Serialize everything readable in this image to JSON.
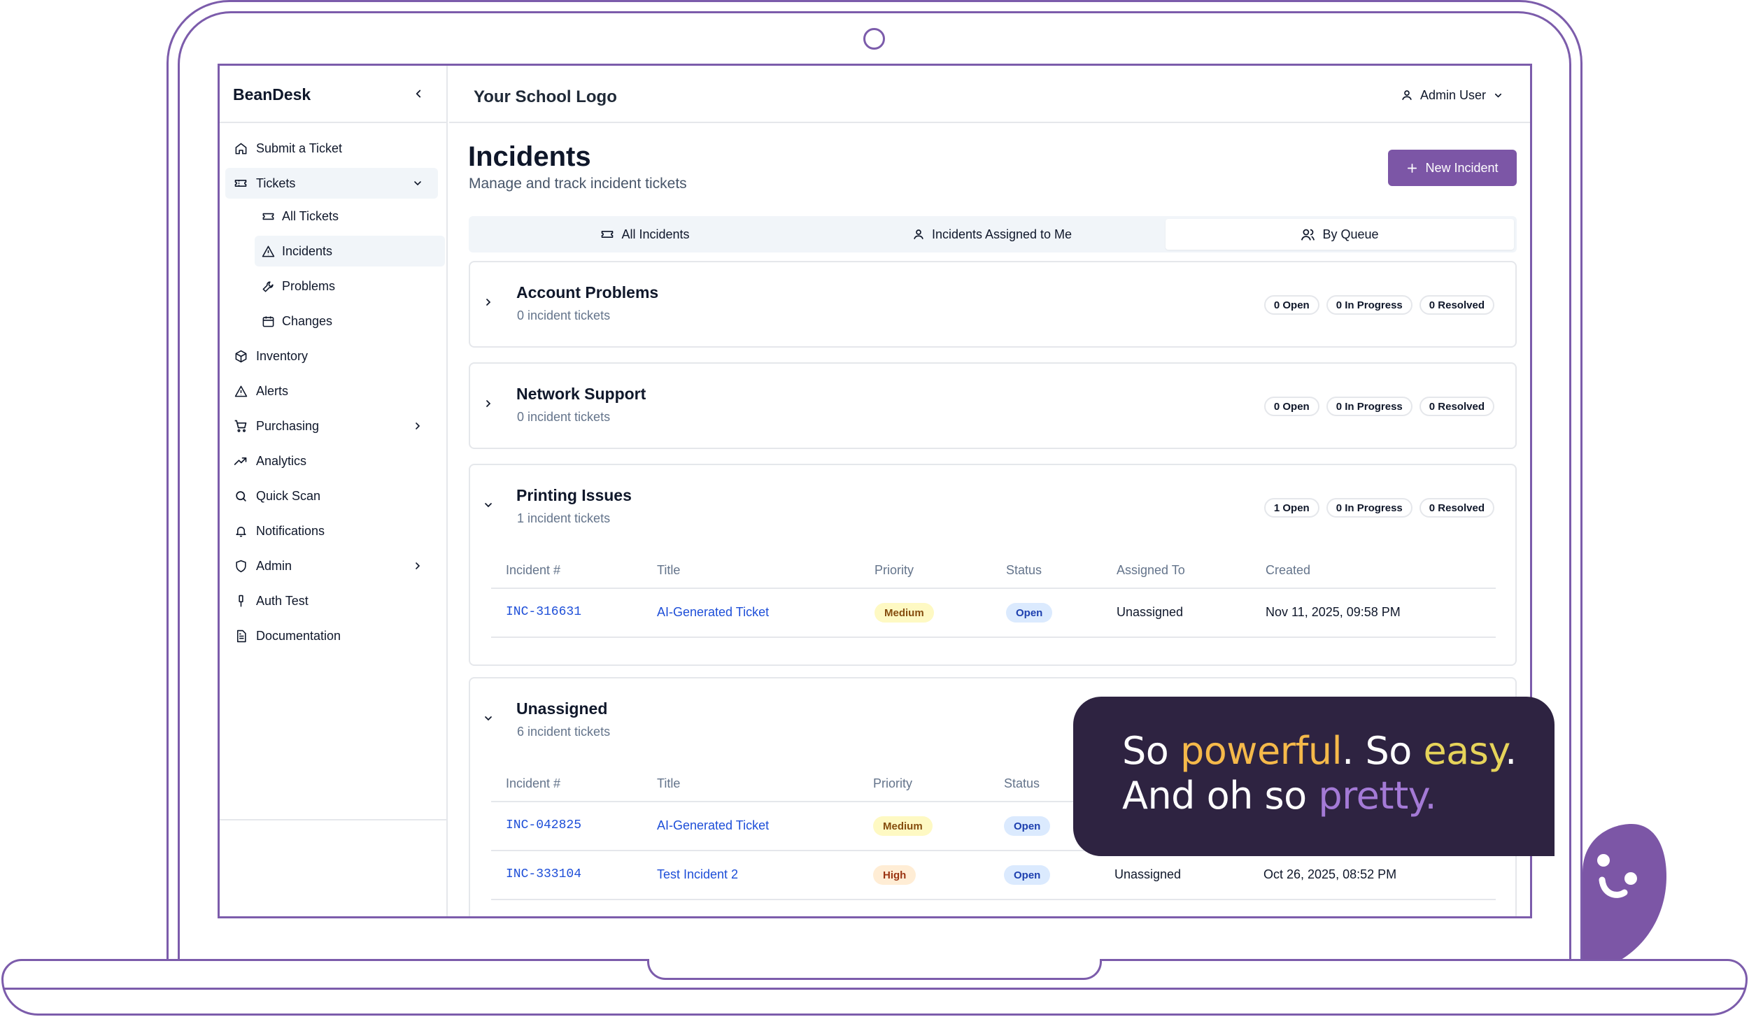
{
  "app": {
    "brand": "BeanDesk",
    "school_logo": "Your School Logo",
    "user": "Admin User"
  },
  "sidebar": {
    "items": [
      {
        "label": "Submit a Ticket",
        "icon": "home-icon"
      },
      {
        "label": "Tickets",
        "icon": "ticket-icon",
        "expanded": true
      },
      {
        "label": "Inventory",
        "icon": "box-icon"
      },
      {
        "label": "Alerts",
        "icon": "alert-triangle-icon"
      },
      {
        "label": "Purchasing",
        "icon": "cart-icon"
      },
      {
        "label": "Analytics",
        "icon": "trending-up-icon"
      },
      {
        "label": "Quick Scan",
        "icon": "search-icon"
      },
      {
        "label": "Notifications",
        "icon": "bell-icon"
      },
      {
        "label": "Admin",
        "icon": "shield-icon"
      },
      {
        "label": "Auth Test",
        "icon": "key-icon"
      },
      {
        "label": "Documentation",
        "icon": "document-icon"
      }
    ],
    "tickets_sub": [
      {
        "label": "All Tickets",
        "icon": "ticket-icon"
      },
      {
        "label": "Incidents",
        "icon": "alert-triangle-icon",
        "active": true
      },
      {
        "label": "Problems",
        "icon": "wrench-icon"
      },
      {
        "label": "Changes",
        "icon": "calendar-icon"
      }
    ]
  },
  "page": {
    "title": "Incidents",
    "subtitle": "Manage and track incident tickets",
    "new_button": "New Incident",
    "tabs": [
      {
        "label": "All Incidents",
        "icon": "ticket-icon"
      },
      {
        "label": "Incidents Assigned to Me",
        "icon": "user-icon"
      },
      {
        "label": "By Queue",
        "icon": "users-icon",
        "active": true
      }
    ]
  },
  "table_headers": [
    "Incident #",
    "Title",
    "Priority",
    "Status",
    "Assigned To",
    "Created"
  ],
  "groups": [
    {
      "name": "Account Problems",
      "count": "0 incident tickets",
      "open": "0 Open",
      "in_progress": "0 In Progress",
      "resolved": "0 Resolved",
      "expanded": false
    },
    {
      "name": "Network Support",
      "count": "0 incident tickets",
      "open": "0 Open",
      "in_progress": "0 In Progress",
      "resolved": "0 Resolved",
      "expanded": false
    },
    {
      "name": "Printing Issues",
      "count": "1 incident tickets",
      "open": "1 Open",
      "in_progress": "0 In Progress",
      "resolved": "0 Resolved",
      "expanded": true,
      "rows": [
        {
          "id": "INC-316631",
          "title": "AI-Generated Ticket",
          "priority": "Medium",
          "status": "Open",
          "assigned": "Unassigned",
          "created": "Nov 11, 2025, 09:58 PM"
        }
      ]
    },
    {
      "name": "Unassigned",
      "count": "6 incident tickets",
      "expanded": true,
      "rows": [
        {
          "id": "INC-042825",
          "title": "AI-Generated Ticket",
          "priority": "Medium",
          "status": "Open"
        },
        {
          "id": "INC-333104",
          "title": "Test Incident 2",
          "priority": "High",
          "status": "Open",
          "assigned": "Unassigned",
          "created": "Oct 26, 2025, 08:52 PM"
        }
      ]
    }
  ],
  "promo": {
    "line1_a": "So ",
    "line1_b": "powerful",
    "line1_c": ". So ",
    "line1_d": "easy",
    "line1_e": ".",
    "line2_a": "And oh so ",
    "line2_b": "pretty."
  },
  "colors": {
    "accent": "#7c56a6",
    "frame": "#7c5cab",
    "promo_bg": "#2e2341",
    "link": "#1d4ed8"
  }
}
